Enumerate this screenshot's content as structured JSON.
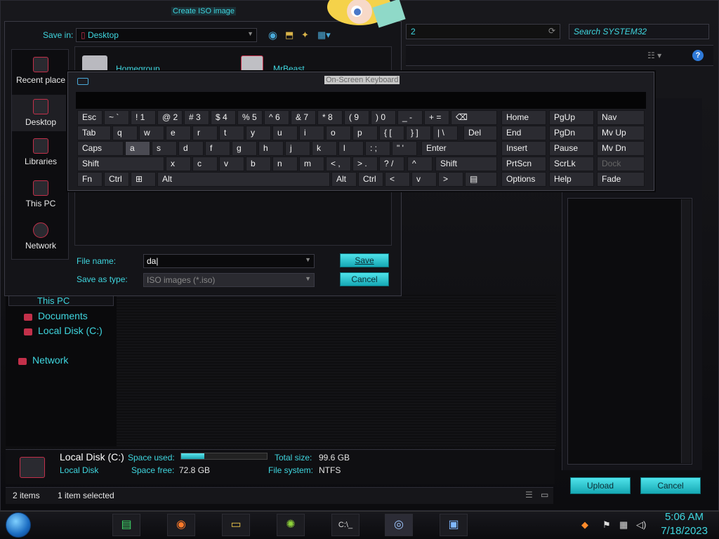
{
  "window": {
    "search_placeholder": "Search SYSTEM32",
    "address_value": "2"
  },
  "nav": {
    "this_pc": "This PC",
    "documents": "Documents",
    "local_disk": "Local Disk (C:)",
    "network": "Network"
  },
  "details": {
    "name": "Local Disk (C:)",
    "type": "Local Disk",
    "space_used_label": "Space used:",
    "space_free_label": "Space free:",
    "space_free": "72.8 GB",
    "total_size_label": "Total size:",
    "total_size": "99.6 GB",
    "file_system_label": "File system:",
    "file_system": "NTFS",
    "space_used_fraction": 0.27
  },
  "status": {
    "items": "2 items",
    "selected": "1 item selected"
  },
  "upload": {
    "upload_label": "Upload",
    "cancel_label": "Cancel"
  },
  "dialog": {
    "title": "Create ISO image",
    "save_in_label": "Save in:",
    "save_in_value": "Desktop",
    "places": [
      "Recent place",
      "Desktop",
      "Libraries",
      "This PC",
      "Network"
    ],
    "files": [
      "Homegroup",
      "MrBeast"
    ],
    "file_name_label": "File name:",
    "file_name_value": "da",
    "save_type_label": "Save as type:",
    "save_type_value": "ISO images (*.iso)",
    "save_label": "Save",
    "cancel_label": "Cancel"
  },
  "osk": {
    "title": "On-Screen Keyboard"
  },
  "taskbar": {
    "time": "5:06 AM",
    "date": "7/18/2023"
  },
  "colors": {
    "accent": "#3fd6df",
    "highlight": "#c3304a"
  }
}
